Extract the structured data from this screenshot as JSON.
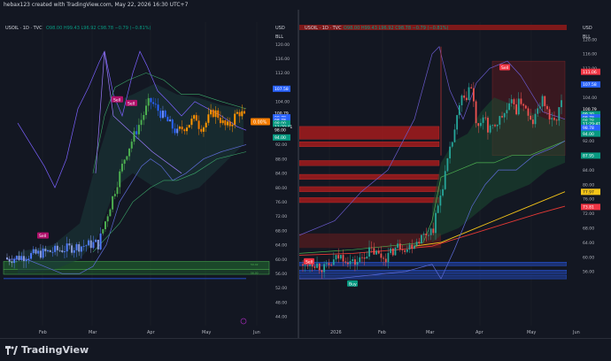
{
  "header": {
    "text": "hebax123 created with TradingView.com, May 22, 2026 16:30 UTC+7"
  },
  "left": {
    "ticker": "USOIL · 1D · TVC",
    "ohlc": "O98.00 H99.43 L96.92 C98.78 −0.79 (−0.81%)",
    "currency": "USD",
    "unit": "BLL",
    "price_ticks": [
      "120.00",
      "116.00",
      "112.00",
      "108.00",
      "104.00",
      "100.00",
      "96.00",
      "92.00",
      "88.00",
      "84.00",
      "80.00",
      "76.00",
      "72.00",
      "68.00",
      "64.00",
      "60.00",
      "56.00",
      "52.00",
      "48.00",
      "44.00"
    ],
    "price_badges": [
      {
        "text": "107.58",
        "color": "#2962ff",
        "value": 107.58
      },
      {
        "text": "100.79",
        "color": "#131722",
        "value": 100.79
      },
      {
        "text": "98.78",
        "color": "#2962ff",
        "value": 99.6
      },
      {
        "text": "98.78",
        "color": "#2962ff",
        "value": 98.78
      },
      {
        "text": "98.00",
        "color": "#089981",
        "value": 97.9
      },
      {
        "text": "11:29:41",
        "color": "#089981",
        "value": 97.0
      },
      {
        "text": "98.00",
        "color": "#131722",
        "value": 96.1
      },
      {
        "text": "94.00",
        "color": "#089981",
        "value": 94.0
      }
    ],
    "pct_badge": {
      "text": "0.00%",
      "color": "#f57c00"
    },
    "time_labels": [
      "Feb",
      "Mar",
      "Apr",
      "May",
      "Jun"
    ],
    "signals": [
      {
        "text": "Sell",
        "color": "#b0106a"
      },
      {
        "text": "Sell",
        "color": "#b0106a"
      },
      {
        "text": "Sell",
        "color": "#b0106a"
      }
    ],
    "zone_labels": [
      "59.42",
      "56.00"
    ]
  },
  "right": {
    "ticker": "USOIL · 1D · TVC",
    "ohlc": "O98.00 H99.43 L96.92 C98.78 −0.79 (−0.81%)",
    "currency": "USD",
    "unit": "BLL",
    "price_ticks": [
      "120.00",
      "116.00",
      "112.00",
      "108.00",
      "104.00",
      "100.00",
      "96.00",
      "92.00",
      "88.00",
      "84.00",
      "80.00",
      "76.00",
      "72.00",
      "68.00",
      "64.00",
      "60.00",
      "56.00"
    ],
    "price_badges": [
      {
        "text": "111.06",
        "color": "#f23645",
        "value": 111.06
      },
      {
        "text": "107.58",
        "color": "#2962ff",
        "value": 107.58
      },
      {
        "text": "100.79",
        "color": "#131722",
        "value": 100.79
      },
      {
        "text": "99.30",
        "color": "#089981",
        "value": 99.4
      },
      {
        "text": "98.78",
        "color": "#2962ff",
        "value": 98.5
      },
      {
        "text": "98.78",
        "color": "#089981",
        "value": 97.6
      },
      {
        "text": "11:29:41",
        "color": "#089981",
        "value": 96.7
      },
      {
        "text": "98.78",
        "color": "#2962ff",
        "value": 95.6
      },
      {
        "text": "94.00",
        "color": "#089981",
        "value": 94.0
      },
      {
        "text": "87.95",
        "color": "#089981",
        "value": 87.95
      },
      {
        "text": "77.97",
        "color": "#f5c518",
        "value": 77.97
      },
      {
        "text": "73.81",
        "color": "#f23645",
        "value": 73.81
      }
    ],
    "time_labels": [
      "2026",
      "Feb",
      "Mar",
      "Apr",
      "May",
      "Jun"
    ],
    "signals": [
      {
        "text": "Sell",
        "color": "#f23645"
      },
      {
        "text": "Sell",
        "color": "#f23645"
      },
      {
        "text": "Buy",
        "color": "#089981"
      }
    ]
  },
  "footer": {
    "brand": "TradingView"
  }
}
